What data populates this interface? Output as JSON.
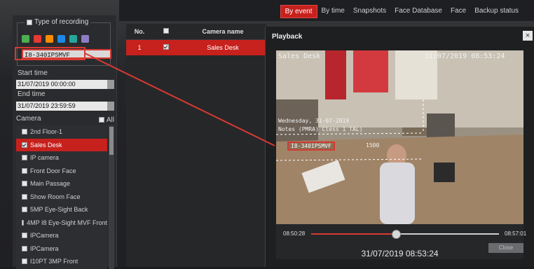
{
  "tabs": [
    {
      "label": "By event",
      "active": true
    },
    {
      "label": "By time",
      "active": false
    },
    {
      "label": "Snapshots",
      "active": false
    },
    {
      "label": "Face Database",
      "active": false
    },
    {
      "label": "Face",
      "active": false
    },
    {
      "label": "Backup status",
      "active": false
    }
  ],
  "sidebar": {
    "type_of_recording": "Type of recording",
    "device_value": "I8-340IPSMVF",
    "start_time_label": "Start time",
    "start_time_value": "31/07/2019 00:00:00",
    "end_time_label": "End time",
    "end_time_value": "31/07/2019 23:59:59",
    "camera_label": "Camera",
    "all_label": "All",
    "cameras": [
      {
        "label": "2nd Floor-1",
        "checked": false
      },
      {
        "label": "Sales Desk",
        "checked": true
      },
      {
        "label": "IP camera",
        "checked": false
      },
      {
        "label": "Front Door Face",
        "checked": false
      },
      {
        "label": "Main Passage",
        "checked": false
      },
      {
        "label": "Show Room Face",
        "checked": false
      },
      {
        "label": "5MP Eye-Sight Back",
        "checked": false
      },
      {
        "label": "4MP I8 Eye-Sight MVF Front",
        "checked": false
      },
      {
        "label": "IPCamera",
        "checked": false
      },
      {
        "label": "IPCamera",
        "checked": false
      },
      {
        "label": "I10PT 3MP Front",
        "checked": false
      }
    ]
  },
  "table": {
    "headers": {
      "no": "No.",
      "camera": "Camera name"
    },
    "rows": [
      {
        "no": "1",
        "checked": true,
        "camera": "Sales Desk"
      }
    ]
  },
  "playback": {
    "title": "Playback",
    "close_glyph": "×",
    "osd_camera": "Sales Desk",
    "osd_datetime": "31/07/2019 08:53:24",
    "osd_line1": "Wednesday, 31-07-2019",
    "osd_line2": "Notes (PMRA) Cless 1 TAL)",
    "osd_id": "I8-340IPSMVF",
    "osd_num": "1500",
    "time_start": "08:50:28",
    "time_end": "08:57:01",
    "progress": 0.45,
    "current_time": "31/07/2019 08:53:24",
    "ok_label": "Close"
  },
  "colors": {
    "accent": "#c7211d",
    "callout": "#d63a33"
  }
}
